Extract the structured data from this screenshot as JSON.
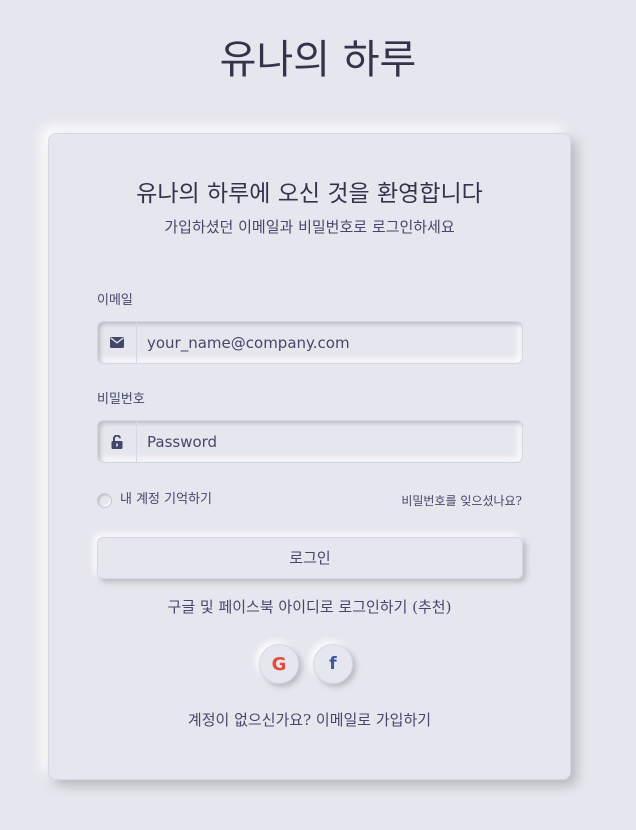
{
  "site": {
    "title": "유나의 하루"
  },
  "login_card": {
    "heading": "유나의 하루에 오신 것을 환영합니다",
    "subheading": "가입하셨던 이메일과 비밀번호로 로그인하세요",
    "email": {
      "label": "이메일",
      "placeholder": "your_name@company.com",
      "value": "",
      "icon": "envelope-icon"
    },
    "password": {
      "label": "비밀번호",
      "placeholder": "Password",
      "value": "",
      "icon": "unlock-icon"
    },
    "remember_me": {
      "label": "내 계정 기억하기",
      "checked": false
    },
    "forgot_password_link": "비밀번호를 잊으셨나요?",
    "login_button": "로그인",
    "social_login_text": "구글 및 페이스북 아이디로 로그인하기 (추천)",
    "social_buttons": [
      {
        "name": "google",
        "glyph": "G",
        "icon": "google-icon",
        "color": "#e24c3c"
      },
      {
        "name": "facebook",
        "glyph": "f",
        "icon": "facebook-icon",
        "color": "#3b5a9a"
      }
    ],
    "signup_link": "계정이 없으신가요? 이메일로 가입하기"
  },
  "colors": {
    "background": "#e6e7ee",
    "text": "#44476a",
    "heading": "#31344b"
  }
}
